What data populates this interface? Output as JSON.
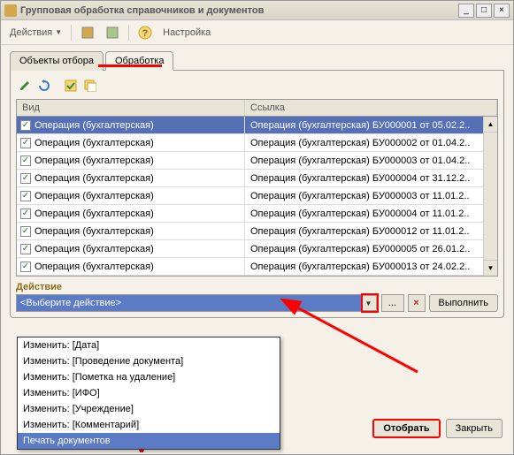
{
  "window": {
    "title": "Групповая обработка справочников и документов"
  },
  "toolbar": {
    "actions": "Действия",
    "settings": "Настройка"
  },
  "tabs": {
    "tab1": "Объекты отбора",
    "tab2": "Обработка"
  },
  "table": {
    "header_vid": "Вид",
    "header_link": "Ссылка",
    "rows": [
      {
        "vid": "Операция (бухгалтерская)",
        "link": "Операция (бухгалтерская) БУ000001 от 05.02.2..",
        "selected": true
      },
      {
        "vid": "Операция (бухгалтерская)",
        "link": "Операция (бухгалтерская) БУ000002 от 01.04.2.."
      },
      {
        "vid": "Операция (бухгалтерская)",
        "link": "Операция (бухгалтерская) БУ000003 от 01.04.2.."
      },
      {
        "vid": "Операция (бухгалтерская)",
        "link": "Операция (бухгалтерская) БУ000004 от 31.12.2.."
      },
      {
        "vid": "Операция (бухгалтерская)",
        "link": "Операция (бухгалтерская) БУ000003 от 11.01.2.."
      },
      {
        "vid": "Операция (бухгалтерская)",
        "link": "Операция (бухгалтерская) БУ000004 от 11.01.2.."
      },
      {
        "vid": "Операция (бухгалтерская)",
        "link": "Операция (бухгалтерская) БУ000012 от 11.01.2.."
      },
      {
        "vid": "Операция (бухгалтерская)",
        "link": "Операция (бухгалтерская) БУ000005 от 26.01.2.."
      },
      {
        "vid": "Операция (бухгалтерская)",
        "link": "Операция (бухгалтерская) БУ000013 от 24.02.2.."
      }
    ]
  },
  "action": {
    "label": "Действие",
    "selected": "<Выберите действие>",
    "execute": "Выполнить",
    "dots": "...",
    "options": [
      "Изменить: [Дата]",
      "Изменить: [Проведение документа]",
      "Изменить: [Пометка на удаление]",
      "Изменить: [ИФО]",
      "Изменить: [Учреждение]",
      "Изменить: [Комментарий]",
      "Печать документов"
    ]
  },
  "buttons": {
    "select": "Отобрать",
    "close": "Закрыть"
  }
}
